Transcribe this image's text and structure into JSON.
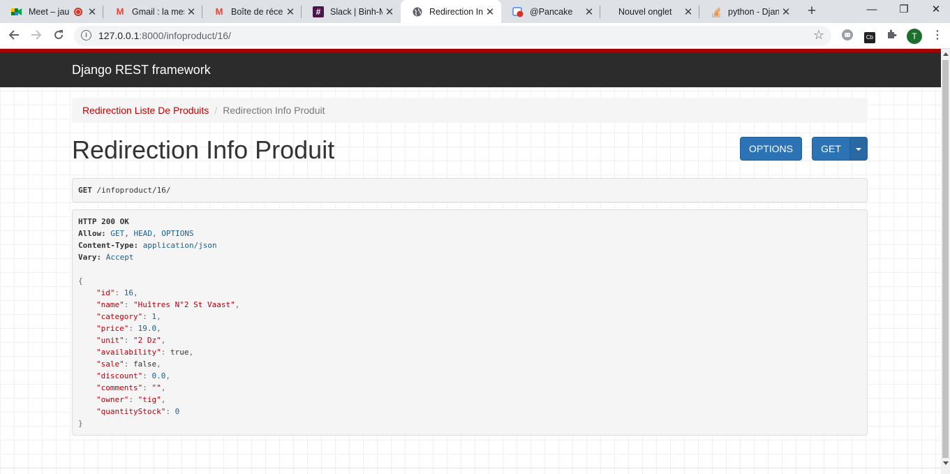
{
  "browser": {
    "tabs": [
      {
        "title": "Meet – jau",
        "icon": "meet-icon",
        "recording": true
      },
      {
        "title": "Gmail : la mess",
        "icon": "gmail-icon"
      },
      {
        "title": "Boîte de récep",
        "icon": "gmail-icon"
      },
      {
        "title": "Slack | Binh-M",
        "icon": "slack-icon"
      },
      {
        "title": "Redirection Inf",
        "icon": "globe-icon",
        "active": true
      },
      {
        "title": "@Pancake",
        "icon": "pancake-icon"
      },
      {
        "title": "Nouvel onglet",
        "icon": ""
      },
      {
        "title": "python - Djang",
        "icon": "stackoverflow-icon"
      }
    ],
    "url_host": "127.0.0.1",
    "url_rest": ":8000/infoproduct/16/",
    "avatar_letter": "T"
  },
  "navbar": {
    "brand": "Django REST framework"
  },
  "breadcrumb": {
    "parent": "Redirection Liste De Produits",
    "current": "Redirection Info Produit"
  },
  "page": {
    "title": "Redirection Info Produit",
    "options_label": "OPTIONS",
    "get_label": "GET"
  },
  "request": {
    "method": "GET",
    "path": "/infoproduct/16/"
  },
  "response": {
    "status": "HTTP 200 OK",
    "headers": [
      {
        "name": "Allow:",
        "value": "GET, HEAD, OPTIONS"
      },
      {
        "name": "Content-Type:",
        "value": "application/json"
      },
      {
        "name": "Vary:",
        "value": "Accept"
      }
    ],
    "body": [
      {
        "key": "\"id\"",
        "value": "16",
        "type": "lit",
        "comma": true
      },
      {
        "key": "\"name\"",
        "value": "\"Huîtres N°2 St Vaast\"",
        "type": "str",
        "comma": true
      },
      {
        "key": "\"category\"",
        "value": "1",
        "type": "lit",
        "comma": true
      },
      {
        "key": "\"price\"",
        "value": "19.0",
        "type": "lit",
        "comma": true
      },
      {
        "key": "\"unit\"",
        "value": "\"2 Dz\"",
        "type": "str",
        "comma": true
      },
      {
        "key": "\"availability\"",
        "value": "true",
        "type": "kw",
        "comma": true
      },
      {
        "key": "\"sale\"",
        "value": "false",
        "type": "kw",
        "comma": true
      },
      {
        "key": "\"discount\"",
        "value": "0.0",
        "type": "lit",
        "comma": true
      },
      {
        "key": "\"comments\"",
        "value": "\"\"",
        "type": "str",
        "comma": true
      },
      {
        "key": "\"owner\"",
        "value": "\"tig\"",
        "type": "str",
        "comma": true
      },
      {
        "key": "\"quantityStock\"",
        "value": "0",
        "type": "lit",
        "comma": false
      }
    ]
  }
}
